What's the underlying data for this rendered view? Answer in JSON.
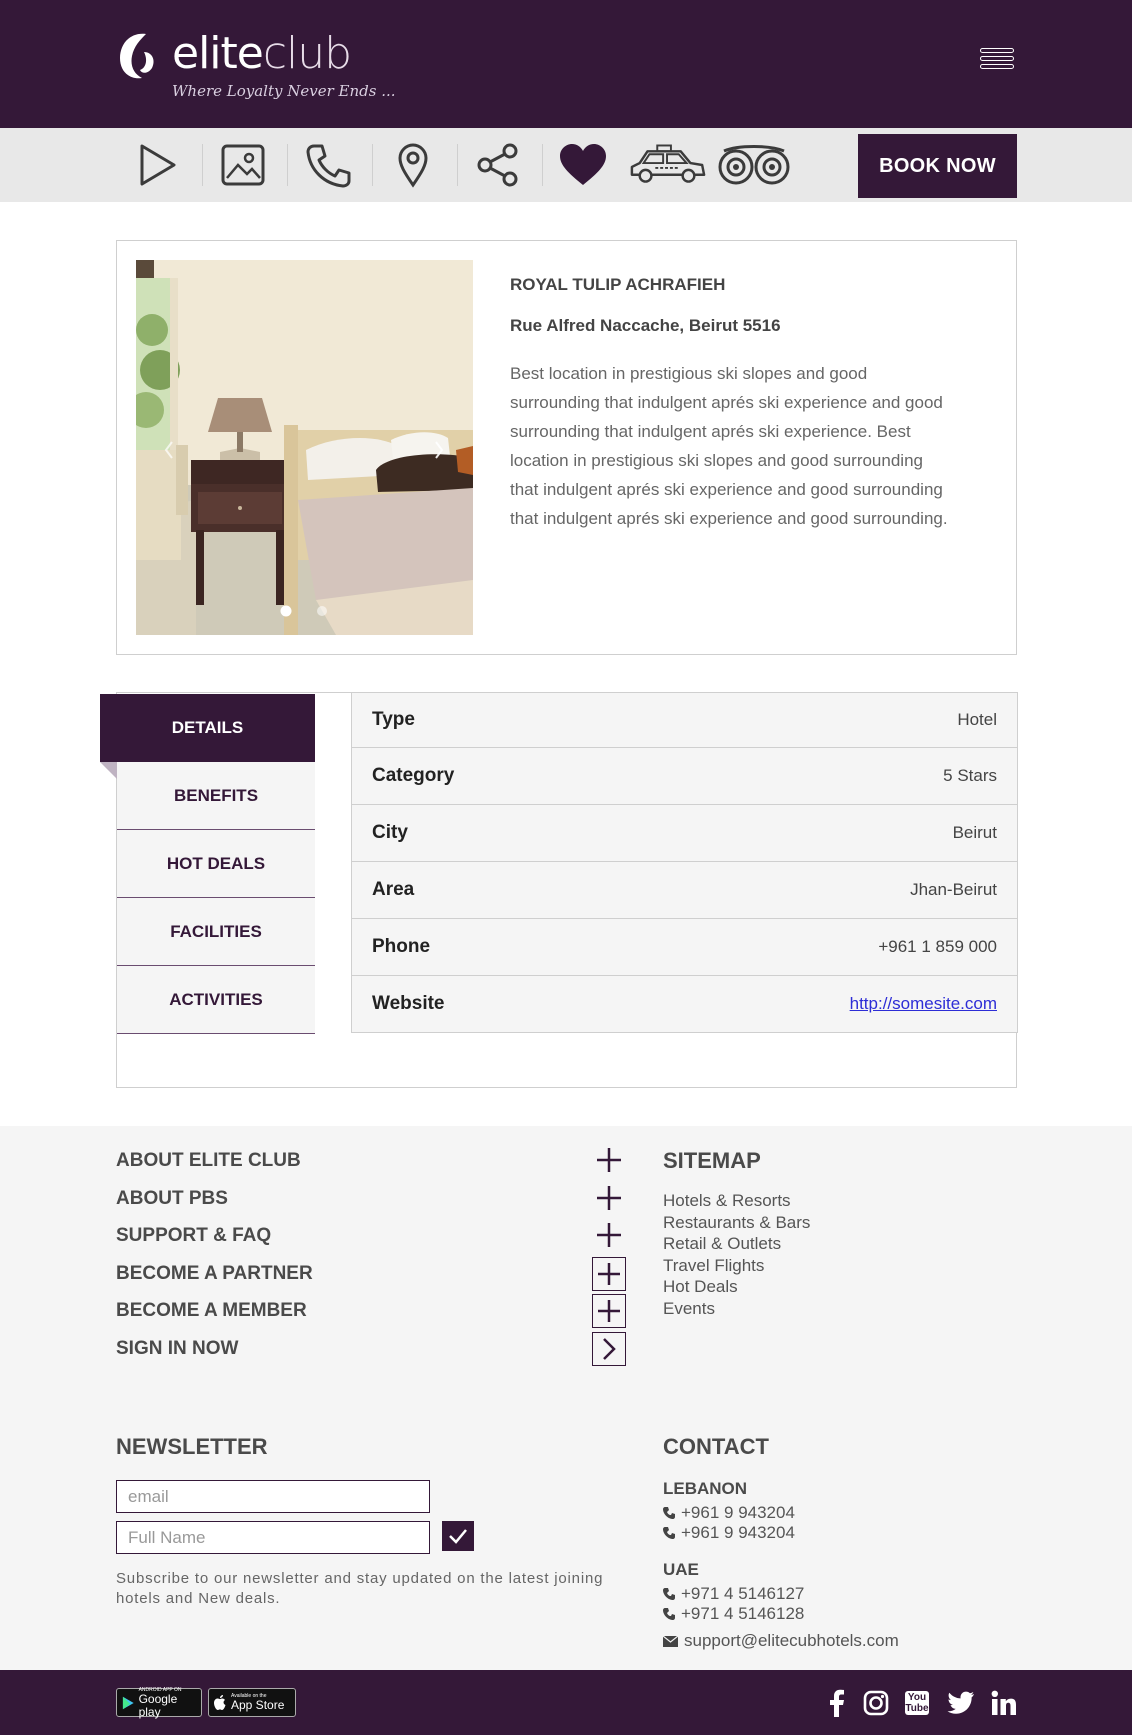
{
  "header": {
    "logo_word_bold": "elite",
    "logo_word_light": "club",
    "logo_tagline": "Where Loyalty Never Ends ...",
    "menu_icon": "hamburger-icon"
  },
  "toolbar": {
    "icons": [
      "play-icon",
      "gallery-icon",
      "phone-icon",
      "location-pin-icon",
      "share-icon",
      "heart-icon",
      "taxi-icon",
      "tripadvisor-icon"
    ],
    "book_label": "BOOK NOW"
  },
  "hotel": {
    "name": "ROYAL TULIP ACHRAFIEH",
    "address": "Rue Alfred Naccache, Beirut 5516",
    "description": "Best location in prestigious ski slopes and good surrounding that indulgent aprés ski experience and good surrounding that indulgent aprés ski experience. Best location in prestigious ski slopes and good surrounding that indulgent aprés ski experience and good surrounding that indulgent aprés ski experience and good surrounding."
  },
  "tabs": [
    "DETAILS",
    "BENEFITS",
    "HOT DEALS",
    "FACILITIES",
    "ACTIVITIES"
  ],
  "details": [
    {
      "key": "Type",
      "value": "Hotel"
    },
    {
      "key": "Category",
      "value": "5 Stars"
    },
    {
      "key": "City",
      "value": "Beirut"
    },
    {
      "key": "Area",
      "value": "Jhan-Beirut"
    },
    {
      "key": "Phone",
      "value": "+961 1 859 000"
    },
    {
      "key": "Website",
      "value": "http://somesite.com"
    }
  ],
  "footer": {
    "links": [
      "ABOUT ELITE CLUB",
      "ABOUT PBS",
      "SUPPORT & FAQ",
      "BECOME A PARTNER",
      "BECOME A MEMBER",
      "SIGN IN NOW"
    ],
    "sitemap_title": "SITEMAP",
    "sitemap": [
      "Hotels & Resorts",
      "Restaurants & Bars",
      "Retail & Outlets",
      "Travel Flights",
      "Hot Deals",
      "Events"
    ],
    "newsletter_title": "NEWSLETTER",
    "email_placeholder": "email",
    "name_placeholder": "Full Name",
    "newsletter_note": "Subscribe to our newsletter and stay updated on the latest joining hotels and New deals.",
    "contact_title": "CONTACT",
    "lebanon_label": "LEBANON",
    "lebanon_phones": [
      "+961 9 943204",
      "+961 9 943204"
    ],
    "uae_label": "UAE",
    "uae_phones": [
      "+971 4 5146127",
      "+971 4 5146128"
    ],
    "email": "support@elitecubhotels.com"
  },
  "bottombar": {
    "google_small": "ANDROID APP ON",
    "google_big": "Google play",
    "apple_small": "Available on the",
    "apple_big": "App Store",
    "social": [
      "facebook-icon",
      "instagram-icon",
      "youtube-icon",
      "twitter-icon",
      "linkedin-icon"
    ],
    "youtube_label": "You Tube"
  },
  "colors": {
    "brand": "#341838",
    "toolbar_bg": "#e8e8e8",
    "footer_bg": "#f5f5f5",
    "link": "#2d2dd6"
  }
}
